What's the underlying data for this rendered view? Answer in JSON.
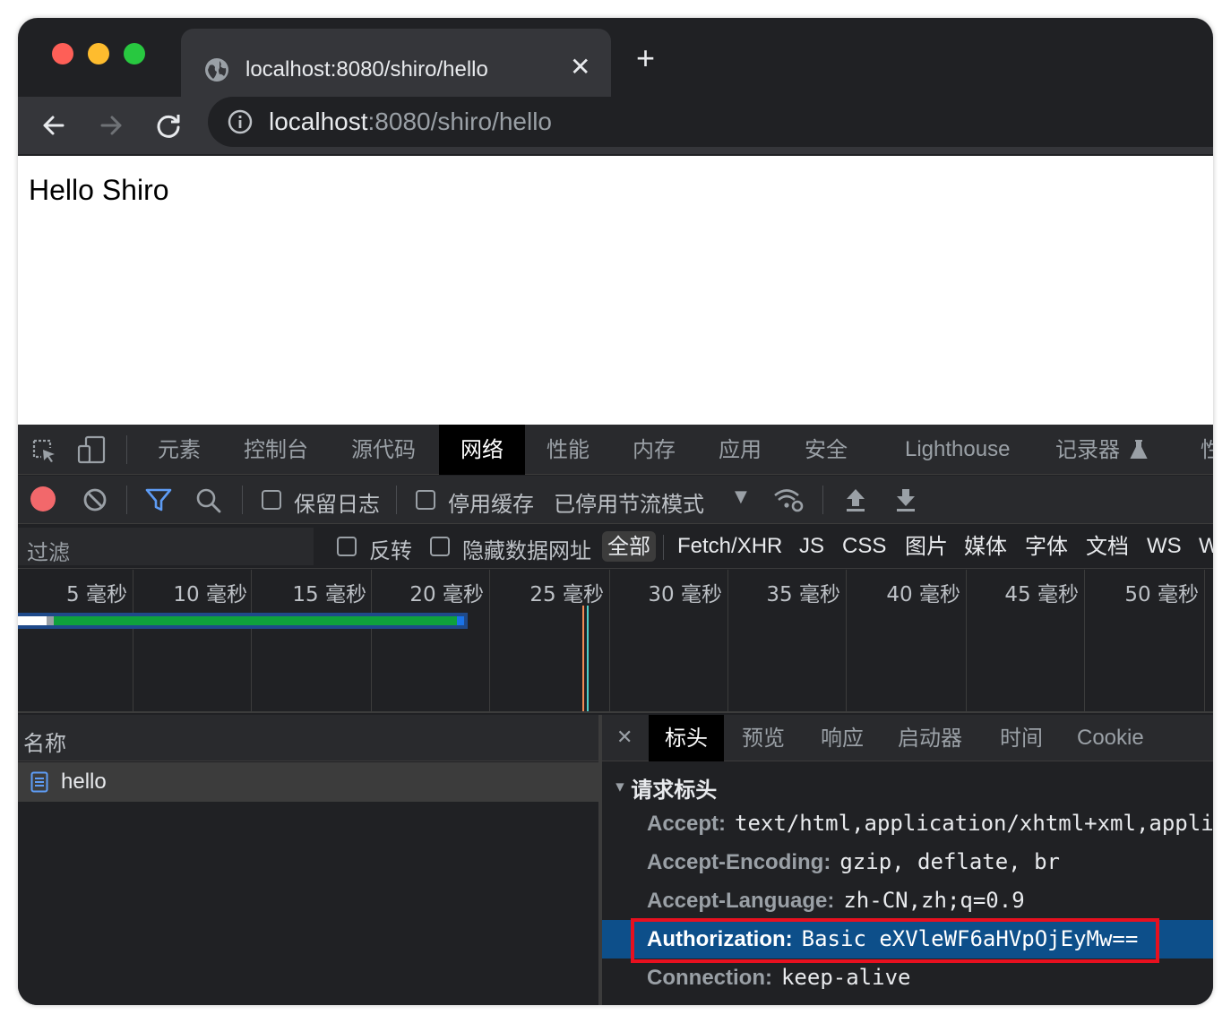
{
  "browser": {
    "tab_title": "localhost:8080/shiro/hello",
    "tab_close": "✕",
    "new_tab": "+",
    "url_host": "localhost",
    "url_rest": ":8080/shiro/hello"
  },
  "page": {
    "text": "Hello Shiro"
  },
  "devtools": {
    "tabs": [
      "元素",
      "控制台",
      "源代码",
      "网络",
      "性能",
      "内存",
      "应用",
      "安全",
      "Lighthouse",
      "记录器",
      "性"
    ],
    "active_tab": "网络",
    "toolbar": {
      "preserve_log": "保留日志",
      "disable_cache": "停用缓存",
      "throttling": "已停用节流模式",
      "dropdown": "▼"
    },
    "filter": {
      "placeholder": "过滤",
      "invert": "反转",
      "hide_data_urls": "隐藏数据网址",
      "types": [
        "全部",
        "Fetch/XHR",
        "JS",
        "CSS",
        "图片",
        "媒体",
        "字体",
        "文档",
        "WS",
        "W"
      ],
      "active_type": "全部"
    },
    "timeline": {
      "ticks": [
        "5 毫秒",
        "10 毫秒",
        "15 毫秒",
        "20 毫秒",
        "25 毫秒",
        "30 毫秒",
        "35 毫秒",
        "40 毫秒",
        "45 毫秒",
        "50 毫秒"
      ]
    },
    "requests": {
      "name_header": "名称",
      "items": [
        "hello"
      ]
    },
    "detail": {
      "close": "✕",
      "tabs": [
        "标头",
        "预览",
        "响应",
        "启动器",
        "时间",
        "Cookie"
      ],
      "active_tab": "标头",
      "section": "请求标头",
      "headers": [
        {
          "key": "Accept:",
          "value": "text/html,application/xhtml+xml,appli"
        },
        {
          "key": "Accept-Encoding:",
          "value": "gzip, deflate, br"
        },
        {
          "key": "Accept-Language:",
          "value": "zh-CN,zh;q=0.9"
        },
        {
          "key": "Authorization:",
          "value": "Basic eXVleWF6aHVpOjEyMw=="
        },
        {
          "key": "Connection:",
          "value": "keep-alive"
        }
      ],
      "highlighted_header": "Authorization:"
    }
  },
  "colors": {
    "highlight_row": "#0d4f8a",
    "highlight_border": "#e8101f",
    "record": "#f2686b",
    "bar_green": "#0fa13d",
    "bar_blue": "#1a73e8"
  }
}
